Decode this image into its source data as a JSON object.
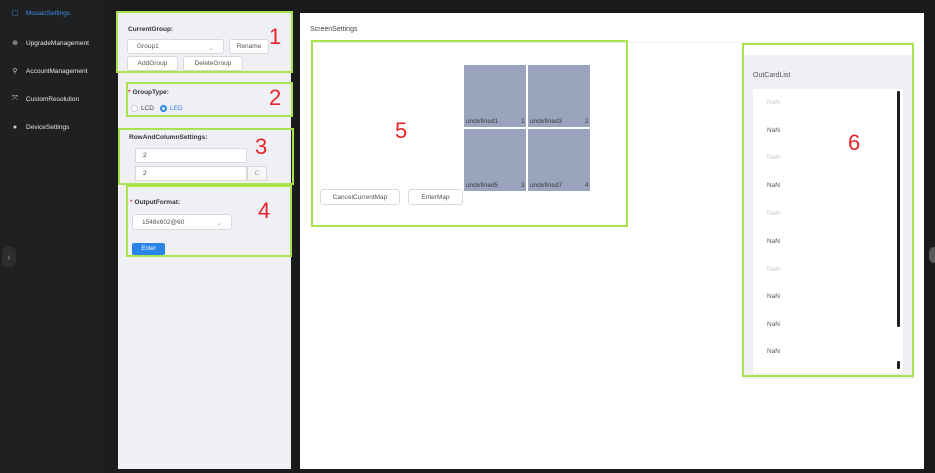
{
  "sidebar": {
    "items": [
      {
        "icon": "mosaic-icon",
        "glyph": "▢",
        "label": "MosaicSettings",
        "active": true
      },
      {
        "icon": "upgrade-icon",
        "glyph": "⊕",
        "label": "UpgradeManagement",
        "active": false
      },
      {
        "icon": "account-icon",
        "glyph": "⚲",
        "label": "AccountManagement",
        "active": false
      },
      {
        "icon": "resolution-icon",
        "glyph": "⤧",
        "label": "CustomResolution",
        "active": false
      },
      {
        "icon": "device-icon",
        "glyph": "●",
        "label": "DeviceSettings",
        "active": false
      }
    ],
    "collapse_glyph": "‹"
  },
  "settings": {
    "current_group": {
      "label": "CurrentGroup:",
      "value": "Group1",
      "rename": "Rename",
      "add": "AddGroup",
      "delete": "DeleteGroup"
    },
    "group_type": {
      "required": "*",
      "label": "GroupType:",
      "options": [
        "LCD",
        "LED"
      ],
      "selected": "LED"
    },
    "row_col": {
      "label": "RowAndColumnSettings:",
      "rows": "2",
      "cols": "2",
      "stepper_glyph": "C"
    },
    "output_format": {
      "required": "*",
      "label": "OutputFormat:",
      "value": "1548x602@60",
      "enter": "Enter"
    }
  },
  "screen_settings": {
    "title": "ScreenSettings",
    "cells": [
      {
        "left_label": "",
        "right_label": ""
      },
      {
        "left_label": "undefined1",
        "right_label": "1"
      },
      {
        "left_label": "undefined3",
        "right_label": "2"
      },
      {
        "left_label": "undefined5",
        "right_label": "3"
      },
      {
        "left_label": "undefined7",
        "right_label": "4"
      }
    ],
    "cancel_map": "CancelCurrentMap",
    "enter_map": "EnterMap"
  },
  "outcard": {
    "title": "OutCardList",
    "items": [
      {
        "text": "NaN",
        "muted": true
      },
      {
        "text": "NaN",
        "muted": false
      },
      {
        "text": "NaN",
        "muted": true
      },
      {
        "text": "NaN",
        "muted": false
      },
      {
        "text": "NaN",
        "muted": true
      },
      {
        "text": "NaN",
        "muted": false
      },
      {
        "text": "NaN",
        "muted": true
      },
      {
        "text": "NaN",
        "muted": false
      },
      {
        "text": "NaN",
        "muted": false
      },
      {
        "text": "NaN",
        "muted": false
      }
    ]
  },
  "annotations": [
    "1",
    "2",
    "3",
    "4",
    "5",
    "6"
  ],
  "colors": {
    "accent": "#2a83e6",
    "annotation_box": "#a9e24a",
    "annotation_number": "#e8232a",
    "sidebar_bg": "#1f2021",
    "panel_bg": "#eef0f5",
    "grid_cell": "#9aa5bd"
  }
}
